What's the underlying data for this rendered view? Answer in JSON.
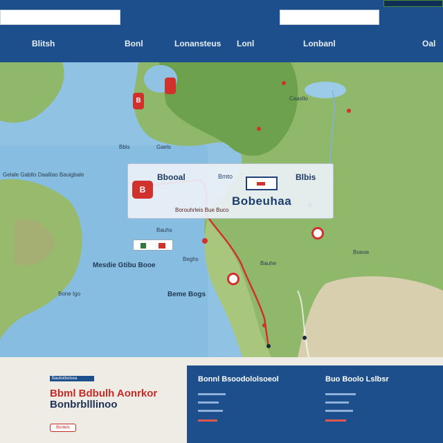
{
  "header": {
    "nav_items": [
      "Blitsh",
      "Bonl",
      "Lonansteus",
      "Lonl",
      "Lonbanl",
      "Oal"
    ]
  },
  "map": {
    "labels": {
      "card_title_left": "Bbooal",
      "card_label_mid": "Bmto",
      "card_title_right": "Blbis",
      "card_big": "Bobeuhaa",
      "card_sub": "Borouhrleis Bue Buco",
      "card_pin": "B",
      "upper_pin": "B",
      "coast_a": "Gelale Gabllo Daalilao Bauigbale",
      "coast_b": "Mesdie Gtibu Booe",
      "coast_c": "Bone Igo",
      "coast_d": "Beme Bogs",
      "top_right_town": "Caasllo",
      "town_1": "Bauhs",
      "town_2": "Boeoe",
      "town_3": "Bauhe",
      "town_4": "Beghs",
      "north_1": "Bbls",
      "north_2": "Gaels"
    }
  },
  "bottom": {
    "promo_tag": "Bautiotbolsea",
    "promo_title": "Bbml Bdbulh Aonrkor",
    "promo_title2": "Bonbrblllinoo",
    "promo_button": "Bonlels",
    "columns": [
      {
        "heading": "Bonnl Bsoodololsoeol"
      },
      {
        "heading": "Buo Boolo Lslbsr"
      }
    ]
  },
  "colors": {
    "brand_blue": "#1c4f8c",
    "route_red": "#d0312d",
    "ocean": "#8fc2e3",
    "land": "#8fb86a"
  }
}
